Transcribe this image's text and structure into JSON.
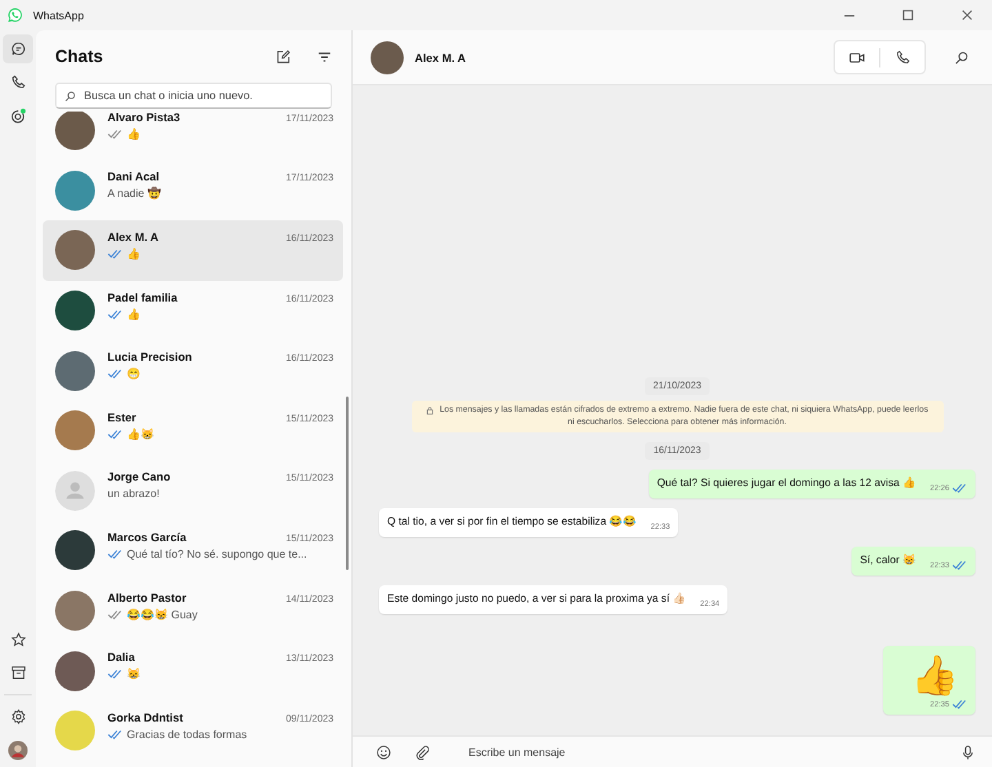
{
  "window": {
    "title": "WhatsApp"
  },
  "nav": {
    "items": [
      {
        "kind": "chats",
        "selected": true
      },
      {
        "kind": "calls",
        "selected": false
      },
      {
        "kind": "status",
        "selected": false
      }
    ],
    "bottom": [
      {
        "kind": "starred"
      },
      {
        "kind": "archived"
      },
      {
        "kind": "settings"
      },
      {
        "kind": "profile"
      }
    ]
  },
  "chat_list": {
    "title": "Chats",
    "search": {
      "placeholder": "Busca un chat o inicia uno nuevo."
    },
    "chats": [
      {
        "name": "Alvaro Pista3",
        "date": "17/11/2023",
        "preview": "👍",
        "ticks": true,
        "read": false,
        "selected": false,
        "has_photo": true
      },
      {
        "name": "Dani Acal",
        "date": "17/11/2023",
        "preview": "A nadie 🤠",
        "ticks": false,
        "selected": false,
        "has_photo": true
      },
      {
        "name": "Alex M. A",
        "date": "16/11/2023",
        "preview": "👍",
        "ticks": true,
        "read": true,
        "selected": true,
        "has_photo": true
      },
      {
        "name": "Padel familia",
        "date": "16/11/2023",
        "preview": "👍",
        "ticks": true,
        "read": true,
        "selected": false,
        "has_photo": true
      },
      {
        "name": "Lucia Precision",
        "date": "16/11/2023",
        "preview": "😁",
        "ticks": true,
        "read": true,
        "selected": false,
        "has_photo": true
      },
      {
        "name": "Ester",
        "date": "15/11/2023",
        "preview": "👍😸",
        "ticks": true,
        "read": true,
        "selected": false,
        "has_photo": true
      },
      {
        "name": "Jorge Cano",
        "date": "15/11/2023",
        "preview": "un abrazo!",
        "ticks": false,
        "selected": false,
        "has_photo": false
      },
      {
        "name": "Marcos García",
        "date": "15/11/2023",
        "preview": "Qué tal tío? No sé. supongo que te...",
        "ticks": true,
        "read": true,
        "selected": false,
        "has_photo": true
      },
      {
        "name": "Alberto Pastor",
        "date": "14/11/2023",
        "preview": "😂😂😸 Guay",
        "ticks": true,
        "read": false,
        "selected": false,
        "has_photo": true
      },
      {
        "name": "Dalia",
        "date": "13/11/2023",
        "preview": "😸",
        "ticks": true,
        "read": true,
        "selected": false,
        "has_photo": true
      },
      {
        "name": "Gorka Ddntist",
        "date": "09/11/2023",
        "preview": "Gracias de todas formas",
        "ticks": true,
        "read": true,
        "selected": false,
        "has_photo": true
      }
    ]
  },
  "conversation": {
    "contact": "Alex M. A",
    "messages": [
      {
        "kind": "date",
        "text": "21/10/2023"
      },
      {
        "kind": "notice",
        "text": "Los mensajes y las llamadas están cifrados de extremo a extremo. Nadie fuera de este chat, ni siquiera WhatsApp, puede leerlos ni escucharlos. Selecciona para obtener más información."
      },
      {
        "kind": "date",
        "text": "16/11/2023"
      },
      {
        "kind": "outgoing",
        "text": "Qué tal? Si quieres jugar el domingo a las 12 avisa 👍",
        "time": "22:26",
        "read": true
      },
      {
        "kind": "incoming",
        "text": "Q tal tio, a ver si por fin el tiempo se estabiliza 😂😂",
        "time": "22:33"
      },
      {
        "kind": "outgoing",
        "text": "Sí, calor 😸",
        "time": "22:33",
        "read": true
      },
      {
        "kind": "incoming",
        "text": "Este domingo justo no  puedo, a ver si para la proxima ya sí 👍🏻",
        "time": "22:34"
      },
      {
        "kind": "sticker",
        "text": "👍",
        "time": "22:35",
        "read": true
      }
    ],
    "composer": {
      "placeholder": "Escribe un mensaje"
    }
  }
}
